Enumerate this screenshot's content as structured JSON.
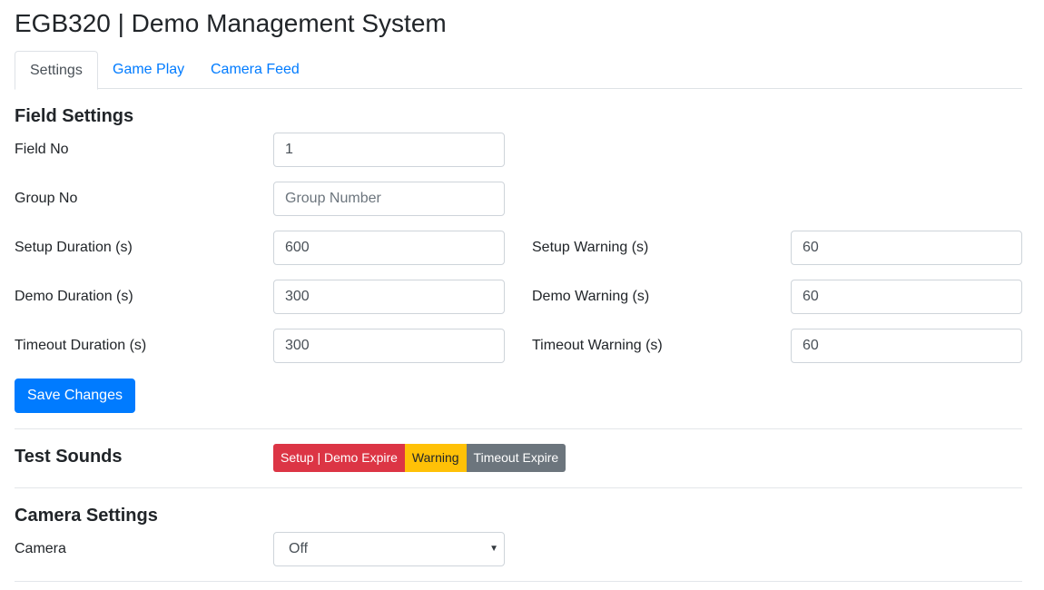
{
  "header": {
    "title": "EGB320 | Demo Management System"
  },
  "tabs": [
    {
      "label": "Settings",
      "active": true
    },
    {
      "label": "Game Play",
      "active": false
    },
    {
      "label": "Camera Feed",
      "active": false
    }
  ],
  "field_settings": {
    "title": "Field Settings",
    "field_no": {
      "label": "Field No",
      "value": "1"
    },
    "group_no": {
      "label": "Group No",
      "value": "",
      "placeholder": "Group Number"
    },
    "setup_duration": {
      "label": "Setup Duration (s)",
      "value": "600"
    },
    "setup_warning": {
      "label": "Setup Warning (s)",
      "value": "60"
    },
    "demo_duration": {
      "label": "Demo Duration (s)",
      "value": "300"
    },
    "demo_warning": {
      "label": "Demo Warning (s)",
      "value": "60"
    },
    "timeout_duration": {
      "label": "Timeout Duration (s)",
      "value": "300"
    },
    "timeout_warning": {
      "label": "Timeout Warning (s)",
      "value": "60"
    },
    "save_label": "Save Changes"
  },
  "test_sounds": {
    "title": "Test Sounds",
    "buttons": {
      "setup_demo_expire": "Setup | Demo Expire",
      "warning": "Warning",
      "timeout_expire": "Timeout Expire"
    }
  },
  "camera_settings": {
    "title": "Camera Settings",
    "camera": {
      "label": "Camera",
      "selected": "Off"
    }
  },
  "colors": {
    "primary": "#007bff",
    "danger": "#dc3545",
    "warning": "#ffc107",
    "secondary": "#6c757d"
  }
}
